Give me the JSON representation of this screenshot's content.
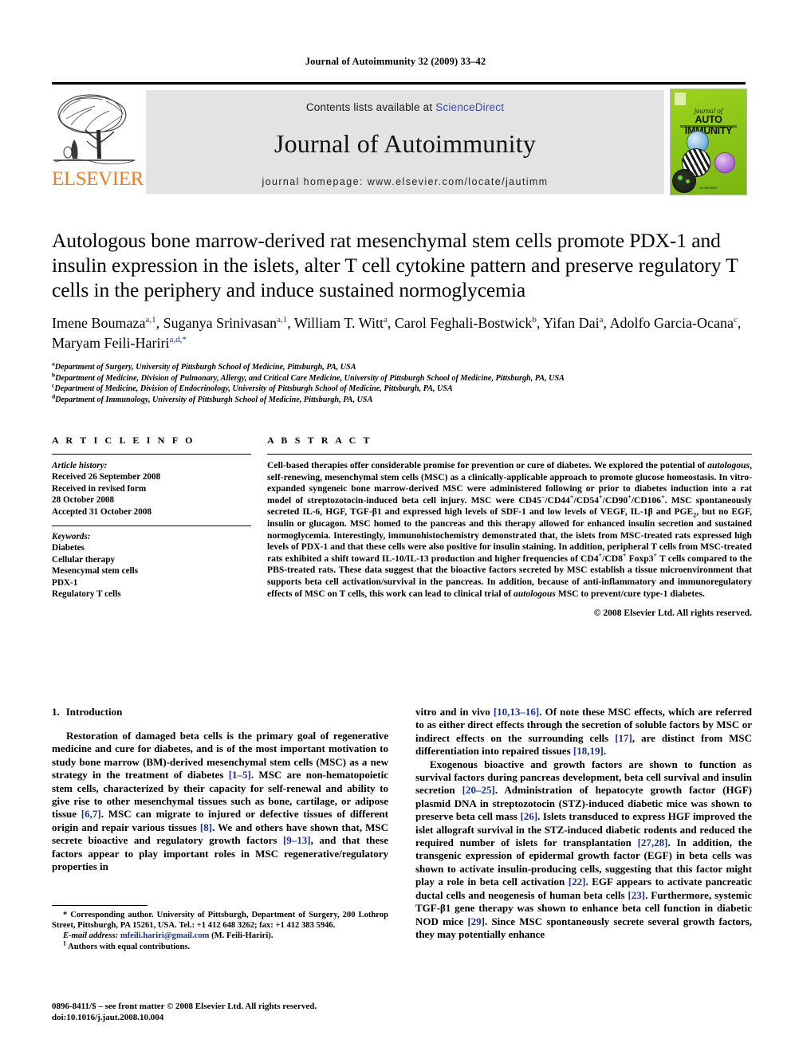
{
  "running_head": "Journal of Autoimmunity 32 (2009) 33–42",
  "masthead": {
    "publisher_name": "ELSEVIER",
    "contents_prefix": "Contents lists available at ",
    "contents_link": "ScienceDirect",
    "journal_title": "Journal of Autoimmunity",
    "homepage": "journal homepage: www.elsevier.com/locate/jautimm",
    "cover": {
      "journal_of": "journal of",
      "title": "AUTO IMMUNITY",
      "footer": "ELSEVIER"
    }
  },
  "article": {
    "title": "Autologous bone marrow-derived rat mesenchymal stem cells promote PDX-1 and insulin expression in the islets, alter T cell cytokine pattern and preserve regulatory T cells in the periphery and induce sustained normoglycemia",
    "authors": [
      {
        "name": "Imene Boumaza",
        "marks": "a,1",
        "sep": ", "
      },
      {
        "name": "Suganya Srinivasan",
        "marks": "a,1",
        "sep": ", "
      },
      {
        "name": "William T. Witt",
        "marks": "a",
        "sep": ", "
      },
      {
        "name": "Carol Feghali-Bostwick",
        "marks": "b",
        "sep": ", "
      },
      {
        "name": "Yifan Dai",
        "marks": "a",
        "sep": ", "
      },
      {
        "name": "Adolfo Garcia-Ocana",
        "marks": "c",
        "sep": ", "
      },
      {
        "name": "Maryam Feili-Hariri",
        "marks": "a,d,*",
        "sep": ""
      }
    ],
    "affiliations": [
      {
        "mark": "a",
        "text": "Department of Surgery, University of Pittsburgh School of Medicine, Pittsburgh, PA, USA"
      },
      {
        "mark": "b",
        "text": "Department of Medicine, Division of Pulmonary, Allergy, and Critical Care Medicine, University of Pittsburgh School of Medicine, Pittsburgh, PA, USA"
      },
      {
        "mark": "c",
        "text": "Department of Medicine, Division of Endocrinology, University of Pittsburgh School of Medicine, Pittsburgh, PA, USA"
      },
      {
        "mark": "d",
        "text": "Department of Immunology, University of Pittsburgh School of Medicine, Pittsburgh, PA, USA"
      }
    ]
  },
  "article_info": {
    "heading": "A R T I C L E   I N F O",
    "history_label": "Article history:",
    "history": [
      "Received 26 September 2008",
      "Received in revised form",
      "28 October 2008",
      "Accepted 31 October 2008"
    ],
    "keywords_label": "Keywords:",
    "keywords": [
      "Diabetes",
      "Cellular therapy",
      "Mesencymal stem cells",
      "PDX-1",
      "Regulatory T cells"
    ]
  },
  "abstract": {
    "heading": "A B S T R A C T",
    "copyright": "© 2008 Elsevier Ltd. All rights reserved."
  },
  "introduction": {
    "number": "1.",
    "heading": "Introduction"
  },
  "footnotes": {
    "corresponding": "* Corresponding author. University of Pittsburgh, Department of Surgery, 200 Lothrop Street, Pittsburgh, PA 15261, USA. Tel.: +1 412 648 3262; fax: +1 412 383 5946.",
    "email_label": "E-mail address:",
    "email": "mfeili.hariri@gmail.com",
    "email_suffix": "(M. Feili-Hariri).",
    "equal_mark": "1",
    "equal_text": "Authors with equal contributions."
  },
  "imprint": {
    "line1": "0896-8411/$ – see front matter © 2008 Elsevier Ltd. All rights reserved.",
    "line2": "doi:10.1016/j.jaut.2008.10.004"
  }
}
